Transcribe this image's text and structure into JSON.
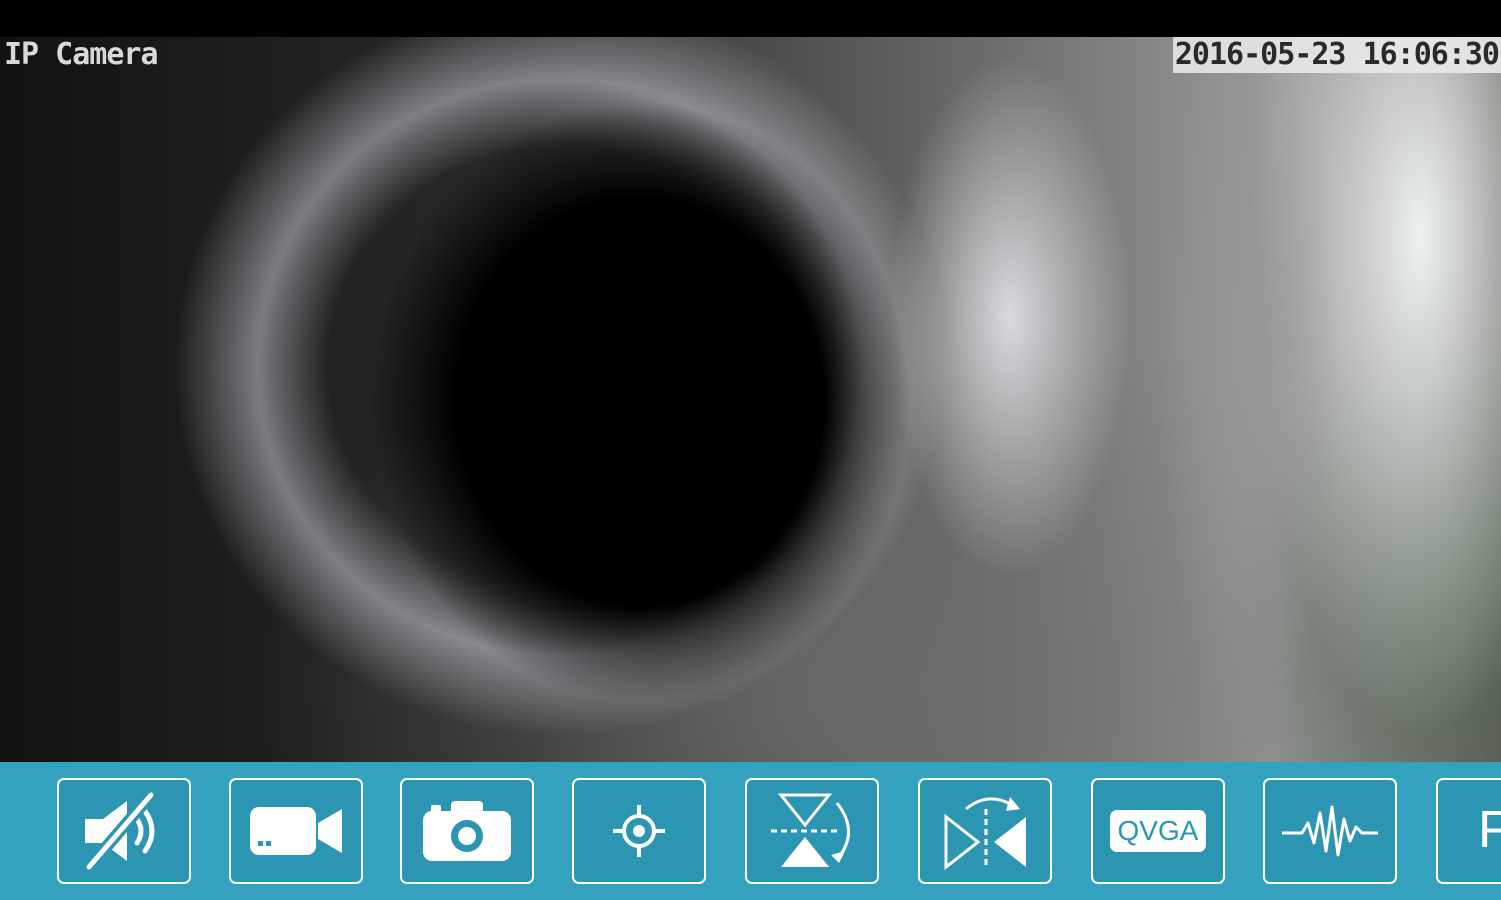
{
  "overlay": {
    "camera_name": "IP Camera",
    "timestamp": "2016-05-23 16:06:30"
  },
  "toolbar": {
    "buttons": [
      {
        "name": "mute-audio",
        "icon": "speaker-muted-icon"
      },
      {
        "name": "record-video",
        "icon": "video-camera-icon"
      },
      {
        "name": "snapshot",
        "icon": "camera-icon"
      },
      {
        "name": "center-ptz",
        "icon": "crosshair-icon"
      },
      {
        "name": "flip-vertical",
        "icon": "flip-vertical-icon"
      },
      {
        "name": "mirror-horizontal",
        "icon": "mirror-horizontal-icon"
      },
      {
        "name": "resolution",
        "icon": "qvga-icon",
        "label": "QVGA"
      },
      {
        "name": "motion-detection",
        "icon": "waveform-icon"
      },
      {
        "name": "more",
        "label": "F"
      }
    ]
  },
  "colors": {
    "toolbar_bg": "#34a2bf",
    "button_bg": "#2c95b2",
    "icon": "#ffffff"
  }
}
